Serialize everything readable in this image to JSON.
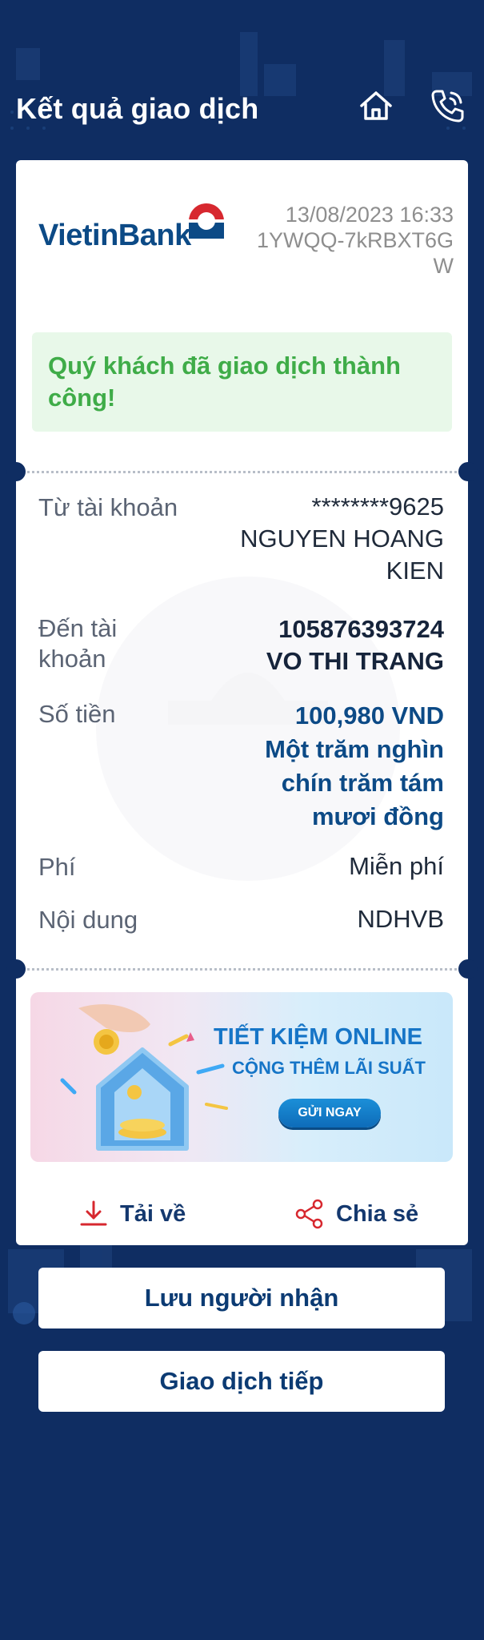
{
  "header": {
    "title": "Kết quả giao dịch",
    "home_icon": "home-icon",
    "support_icon": "phone-icon"
  },
  "receipt": {
    "bank_name": "VietinBank",
    "datetime": "13/08/2023 16:33",
    "transaction_id_line1": "1YWQQ-7kRBXT6G",
    "transaction_id_line2": "W",
    "success_message": "Quý khách đã giao dịch thành công!",
    "rows": [
      {
        "label": "Từ tài khoản",
        "value_lines": [
          "********9625",
          "NGUYEN HOANG",
          "KIEN"
        ]
      },
      {
        "label_lines": [
          "Đến tài",
          "khoản"
        ],
        "value_lines": [
          "105876393724",
          "VO THI TRANG"
        ]
      },
      {
        "label": "Số tiền",
        "value_lines": [
          "100,980 VND",
          "Một trăm nghìn",
          "chín trăm tám",
          "mươi đồng"
        ]
      },
      {
        "label": "Phí",
        "value": "Miễn phí"
      },
      {
        "label": "Nội dung",
        "value": "NDHVB"
      }
    ],
    "promo": {
      "title": "TIẾT KIỆM ONLINE",
      "subtitle": "CỘNG THÊM LÃI SUẤT",
      "button": "GỬI NGAY"
    },
    "download_label": "Tải về",
    "share_label": "Chia sẻ"
  },
  "buttons": {
    "save_recipient": "Lưu người nhận",
    "next_transaction": "Giao dịch tiếp"
  },
  "colors": {
    "background": "#0f2d62",
    "success_text": "#3fac48",
    "amount_blue": "#0c4a86",
    "brand_red": "#d7282f"
  }
}
